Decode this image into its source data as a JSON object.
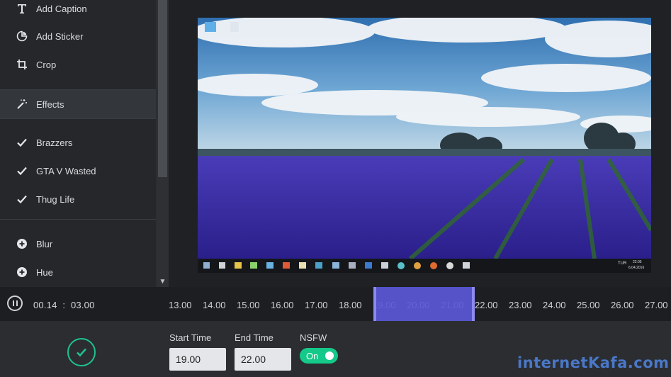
{
  "sidebar": {
    "items": [
      {
        "label": "Add Caption",
        "icon": "text-icon"
      },
      {
        "label": "Add Sticker",
        "icon": "sticker-icon"
      },
      {
        "label": "Crop",
        "icon": "crop-icon"
      },
      {
        "label": "Effects",
        "icon": "magic-wand-icon"
      },
      {
        "label": "Brazzers",
        "icon": "check-icon"
      },
      {
        "label": "GTA V Wasted",
        "icon": "check-icon"
      },
      {
        "label": "Thug Life",
        "icon": "check-icon"
      },
      {
        "label": "Blur",
        "icon": "plus-circle-icon"
      },
      {
        "label": "Hue",
        "icon": "plus-circle-icon"
      }
    ]
  },
  "player": {
    "current_time": "00.14",
    "separator": ":",
    "duration": "03.00"
  },
  "timeline": {
    "ticks": [
      "13.00",
      "14.00",
      "15.00",
      "16.00",
      "17.00",
      "18.00",
      "19.00",
      "20.00",
      "21.00",
      "22.00",
      "23.00",
      "24.00",
      "25.00",
      "26.00",
      "27.00"
    ],
    "selection_start": 19.0,
    "selection_end": 22.0
  },
  "controls": {
    "start_label": "Start Time",
    "start_value": "19.00",
    "end_label": "End Time",
    "end_value": "22.00",
    "nsfw_label": "NSFW",
    "nsfw_state": "On"
  },
  "desktop": {
    "clock_time": "22:05",
    "clock_date": "6.04.2016",
    "lang": "TUR"
  },
  "watermark": "internetKafa.com",
  "colors": {
    "accent_green": "#14c98a",
    "selection_purple": "#5a58d6"
  }
}
